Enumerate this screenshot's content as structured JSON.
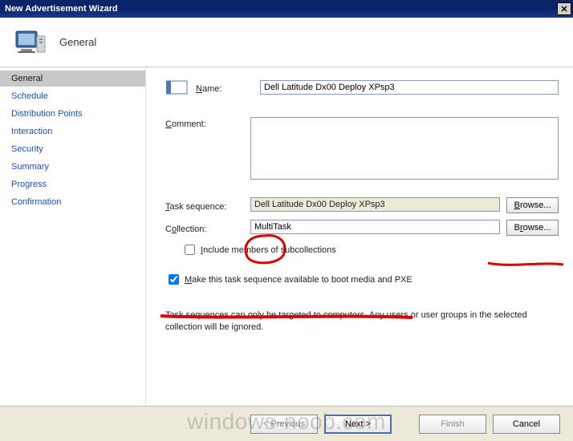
{
  "window": {
    "title": "New Advertisement Wizard"
  },
  "header": {
    "title": "General"
  },
  "sidebar": {
    "items": [
      {
        "label": "General",
        "active": true
      },
      {
        "label": "Schedule"
      },
      {
        "label": "Distribution Points"
      },
      {
        "label": "Interaction"
      },
      {
        "label": "Security"
      },
      {
        "label": "Summary"
      },
      {
        "label": "Progress"
      },
      {
        "label": "Confirmation"
      }
    ]
  },
  "form": {
    "name_label": "Name:",
    "name_value": "Dell Latitude Dx00 Deploy XPsp3",
    "comment_label": "Comment:",
    "comment_value": "",
    "task_sequence_label": "Task sequence:",
    "task_sequence_value": "Dell Latitude Dx00 Deploy XPsp3",
    "collection_label": "Collection:",
    "collection_value": "MultiTask",
    "browse_label": "Browse...",
    "include_sub_label": "Include members of subcollections",
    "include_sub_checked": false,
    "pxe_label": "Make this task sequence available to boot media and PXE",
    "pxe_checked": true,
    "note": "Task sequences can only be targeted to computers.  Any users or user groups in the selected collection will be ignored."
  },
  "footer": {
    "previous_label": "< Previous",
    "next_label": "Next >",
    "finish_label": "Finish",
    "cancel_label": "Cancel"
  },
  "watermark": "windows-noob.com"
}
